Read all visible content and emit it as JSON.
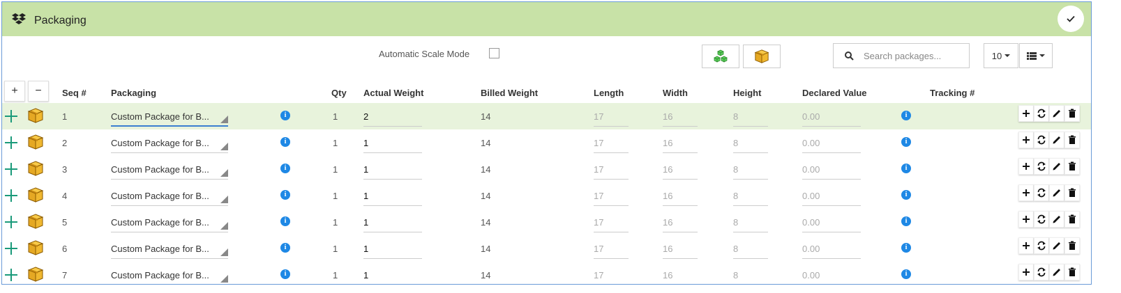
{
  "header": {
    "title": "Packaging",
    "accent": "#c8e2a7"
  },
  "toolbar": {
    "scale_mode_label": "Automatic Scale Mode",
    "search_placeholder": "Search packages...",
    "page_size": "10"
  },
  "columns": {
    "seq": "Seq #",
    "packaging": "Packaging",
    "qty": "Qty",
    "actual_weight": "Actual Weight",
    "billed_weight": "Billed Weight",
    "length": "Length",
    "width": "Width",
    "height": "Height",
    "declared_value": "Declared Value",
    "tracking": "Tracking #"
  },
  "row_buttons": {
    "add": "+",
    "remove": "−"
  },
  "rows": [
    {
      "seq": "1",
      "packaging": "Custom Package for B...",
      "qty": "1",
      "actual_weight": "2",
      "billed_weight": "14",
      "length": "17",
      "width": "16",
      "height": "8",
      "declared_value": "0.00",
      "tracking": ""
    },
    {
      "seq": "2",
      "packaging": "Custom Package for B...",
      "qty": "1",
      "actual_weight": "1",
      "billed_weight": "14",
      "length": "17",
      "width": "16",
      "height": "8",
      "declared_value": "0.00",
      "tracking": ""
    },
    {
      "seq": "3",
      "packaging": "Custom Package for B...",
      "qty": "1",
      "actual_weight": "1",
      "billed_weight": "14",
      "length": "17",
      "width": "16",
      "height": "8",
      "declared_value": "0.00",
      "tracking": ""
    },
    {
      "seq": "4",
      "packaging": "Custom Package for B...",
      "qty": "1",
      "actual_weight": "1",
      "billed_weight": "14",
      "length": "17",
      "width": "16",
      "height": "8",
      "declared_value": "0.00",
      "tracking": ""
    },
    {
      "seq": "5",
      "packaging": "Custom Package for B...",
      "qty": "1",
      "actual_weight": "1",
      "billed_weight": "14",
      "length": "17",
      "width": "16",
      "height": "8",
      "declared_value": "0.00",
      "tracking": ""
    },
    {
      "seq": "6",
      "packaging": "Custom Package for B...",
      "qty": "1",
      "actual_weight": "1",
      "billed_weight": "14",
      "length": "17",
      "width": "16",
      "height": "8",
      "declared_value": "0.00",
      "tracking": ""
    },
    {
      "seq": "7",
      "packaging": "Custom Package for B...",
      "qty": "1",
      "actual_weight": "1",
      "billed_weight": "14",
      "length": "17",
      "width": "16",
      "height": "8",
      "declared_value": "0.00",
      "tracking": ""
    }
  ],
  "info_glyph": "i",
  "selected_row_color": "#e8f3dc"
}
